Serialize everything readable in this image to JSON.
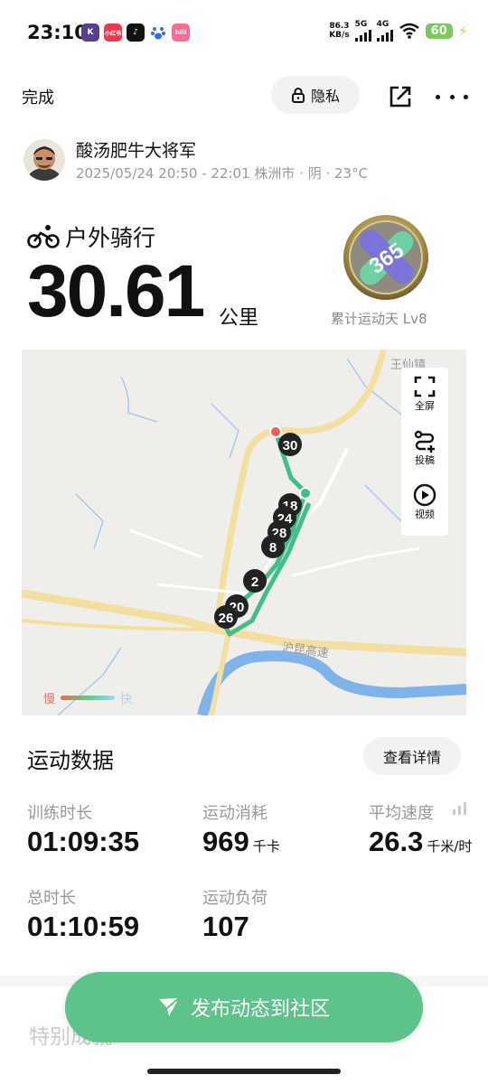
{
  "status_bar": {
    "time": "23:10",
    "net_speed_value": "86.3",
    "net_speed_unit": "KB/s",
    "net1": "5G",
    "net2": "4G",
    "battery": "60",
    "apps": [
      {
        "icon": "keep-app-icon",
        "label": "K",
        "color": "#5a3f8f"
      },
      {
        "icon": "xiaohongshu-app-icon",
        "label": "小红书",
        "color": "#f0374b"
      },
      {
        "icon": "tiktok-app-icon",
        "label": "♪",
        "color": "#111111"
      },
      {
        "icon": "baidu-app-icon",
        "label": "🐾",
        "color": "#ffffff"
      },
      {
        "icon": "bilibili-app-icon",
        "label": "bili",
        "color": "#f56d92"
      }
    ]
  },
  "header": {
    "done_label": "完成",
    "privacy_label": "隐私"
  },
  "user": {
    "name": "酸汤肥牛大将军",
    "meta": "2025/05/24 20:50 - 22:01 株洲市 · 阴 · 23°C"
  },
  "activity": {
    "type": "户外骑行",
    "distance": "30.61",
    "unit": "公里",
    "badge_caption": "累计运动天 Lv8",
    "badge_text": "365"
  },
  "map": {
    "tools": [
      {
        "label": "全屏",
        "icon": "fullscreen-icon"
      },
      {
        "label": "投稿",
        "icon": "submit-route-icon"
      },
      {
        "label": "视频",
        "icon": "video-play-icon"
      }
    ],
    "places": [
      {
        "label": "王仙镇"
      },
      {
        "label": "沪昆高速"
      }
    ],
    "markers": [
      "30",
      "18",
      "24",
      "28",
      "8",
      "2",
      "20",
      "26"
    ],
    "legend_slow": "慢",
    "legend_fast": "快",
    "route_color": "#3fbf8c"
  },
  "data_section": {
    "title": "运动数据",
    "details_label": "查看详情",
    "stats": [
      {
        "label": "训练时长",
        "value": "01:09:35",
        "unit": ""
      },
      {
        "label": "运动消耗",
        "value": "969",
        "unit": "千卡"
      },
      {
        "label": "平均速度",
        "value": "26.3",
        "unit": "千米/时"
      },
      {
        "label": "总时长",
        "value": "01:10:59",
        "unit": ""
      },
      {
        "label": "运动负荷",
        "value": "107",
        "unit": ""
      }
    ]
  },
  "section2_title": "特别成就",
  "publish": {
    "label": "发布动态到社区",
    "color": "#5ec38a"
  }
}
